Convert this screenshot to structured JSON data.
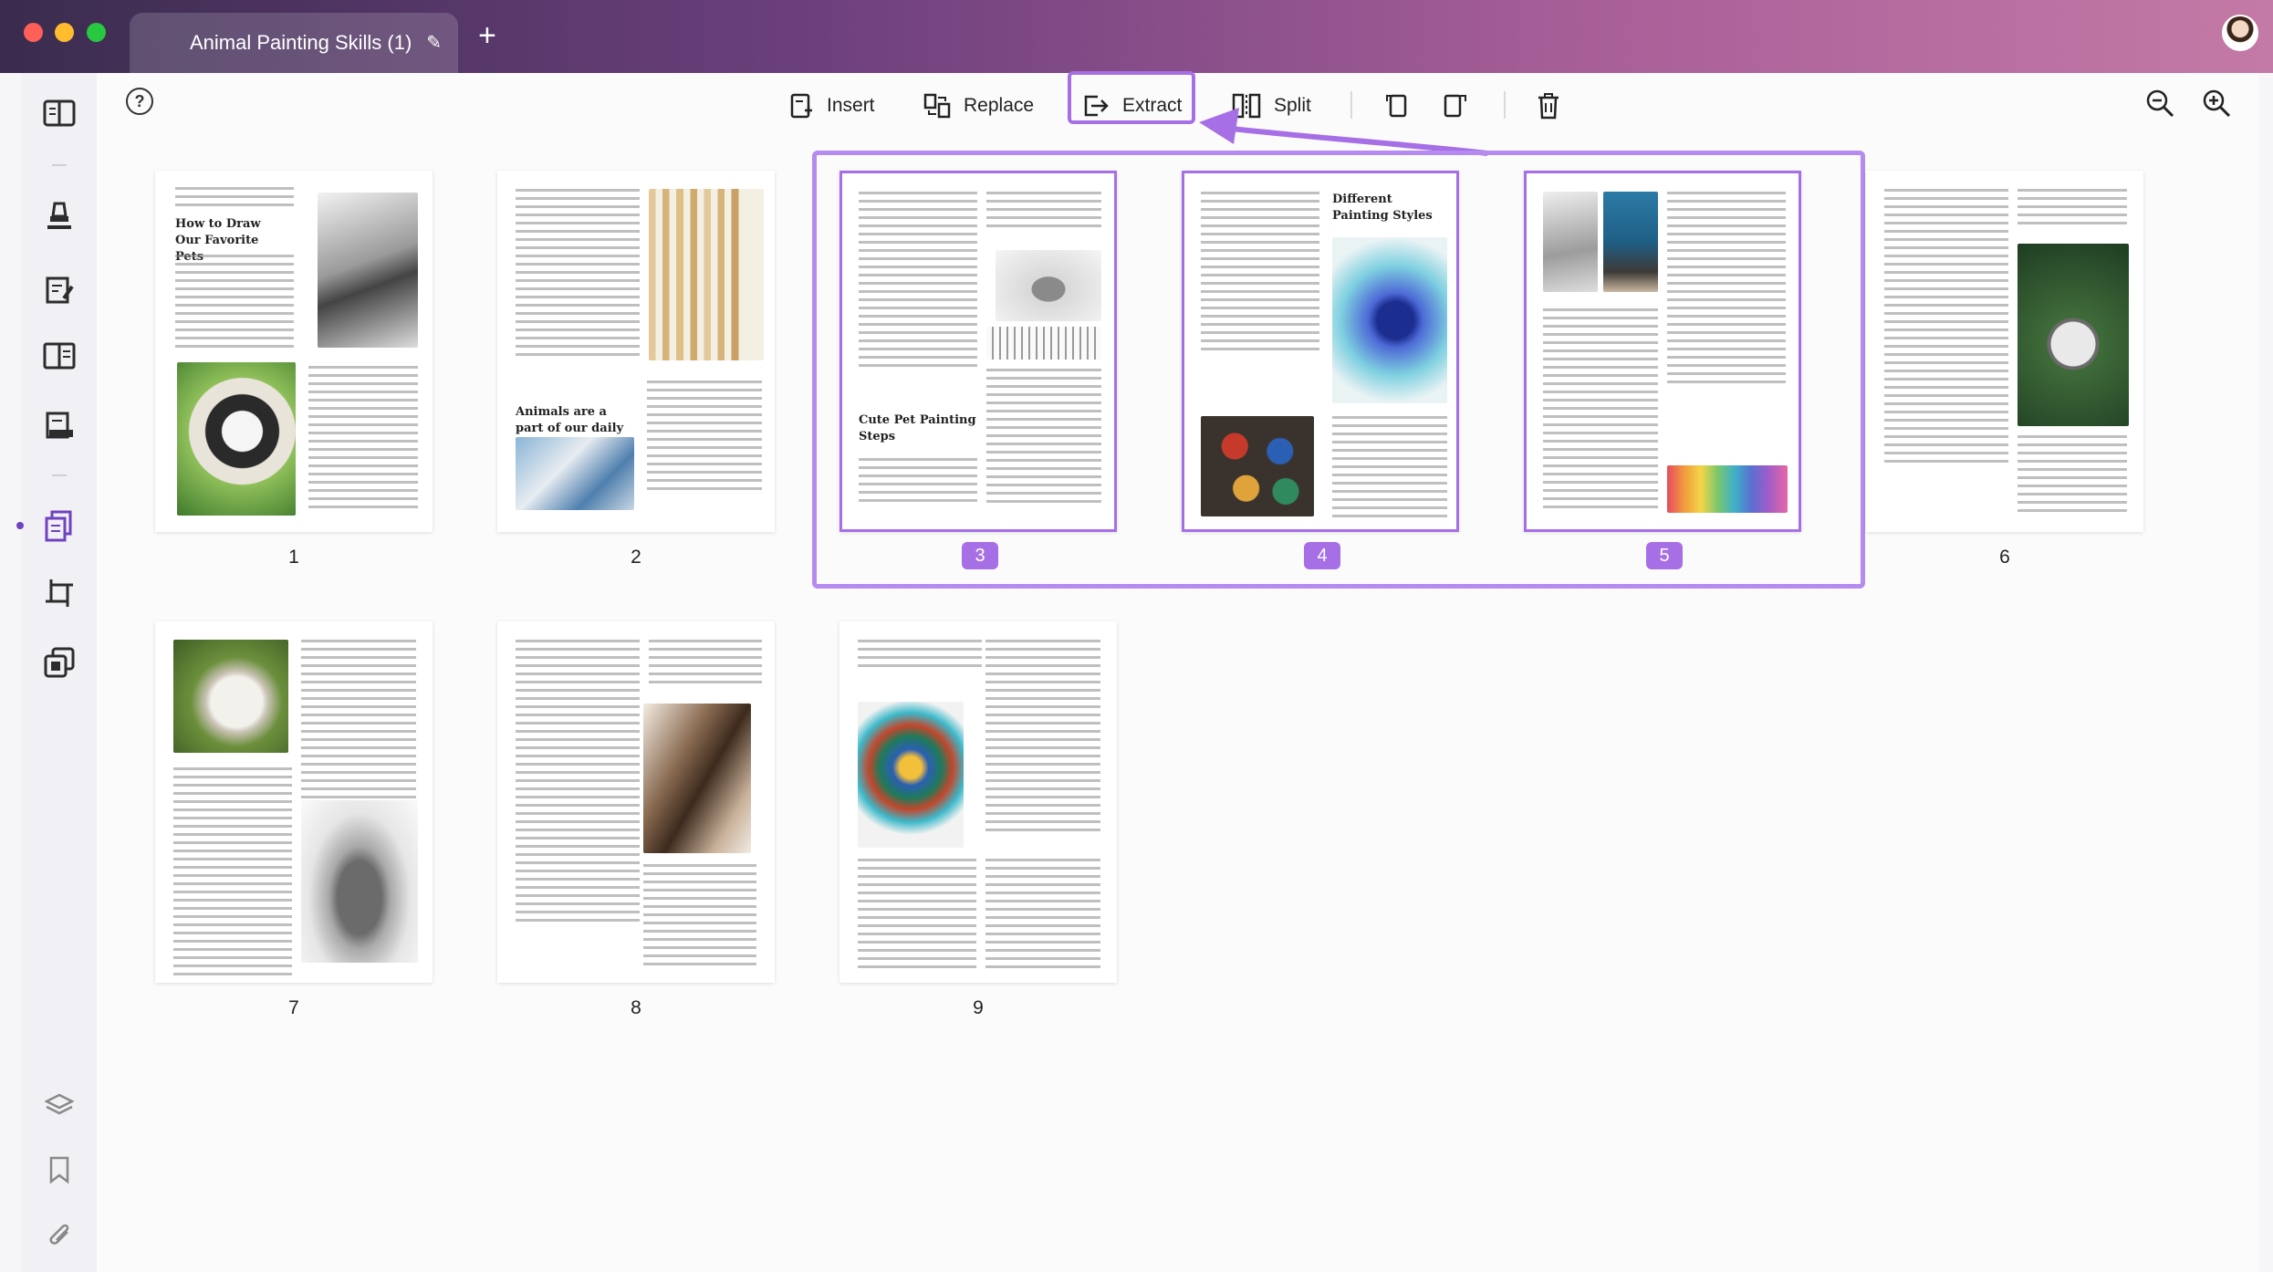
{
  "window": {
    "tab_title": "Animal Painting Skills (1)",
    "tab_add": "+"
  },
  "toolbar": {
    "help": "?",
    "insert": "Insert",
    "replace": "Replace",
    "extract": "Extract",
    "split": "Split"
  },
  "pages": [
    {
      "num": "1",
      "heading": "How to Draw Our Favorite Pets",
      "selected": false
    },
    {
      "num": "2",
      "heading": "Animals are a part of our daily life",
      "selected": false
    },
    {
      "num": "3",
      "heading": "Cute Pet Painting Steps",
      "selected": true
    },
    {
      "num": "4",
      "heading": "Different Painting Styles",
      "selected": true
    },
    {
      "num": "5",
      "heading": "",
      "selected": true
    },
    {
      "num": "6",
      "heading": "",
      "selected": false
    },
    {
      "num": "7",
      "heading": "",
      "selected": false
    },
    {
      "num": "8",
      "heading": "",
      "selected": false
    },
    {
      "num": "9",
      "heading": "",
      "selected": false
    }
  ],
  "colors": {
    "accent": "#a66fe6",
    "titlebar_start": "#3a2c4e",
    "titlebar_end": "#c47aa6"
  }
}
